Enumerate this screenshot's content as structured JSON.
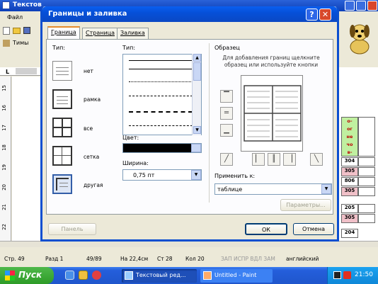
{
  "background_window": {
    "title": "Текстов",
    "menu": "Файл",
    "toolbar_text": "Тимы",
    "ruler_marks": [
      "15",
      "16",
      "17",
      "18",
      "19",
      "20",
      "21",
      "22"
    ],
    "table_cells": [
      {
        "text": "о-\nог\nне\nчо\nв-",
        "bg": "#c0f0a0"
      },
      {
        "text": "304",
        "bg": "#ffffff"
      },
      {
        "text": "305",
        "bg": "#f0c0c8"
      },
      {
        "text": "806",
        "bg": "#ffffff"
      },
      {
        "text": "305",
        "bg": "#f0c0c8"
      },
      {
        "text": "205",
        "bg": "#ffffff"
      },
      {
        "text": "305",
        "bg": "#f0c0c8"
      },
      {
        "text": "204",
        "bg": "#ffffff"
      }
    ]
  },
  "dialog": {
    "title": "Границы и заливка",
    "help": "?",
    "close": "✕",
    "tabs": [
      {
        "label": "Граница",
        "active": true
      },
      {
        "label": "Страница",
        "active": false
      },
      {
        "label": "Заливка",
        "active": false
      }
    ],
    "type_label": "Тип:",
    "presets": [
      "нет",
      "рамка",
      "все",
      "сетка",
      "другая"
    ],
    "style_label": "Тип:",
    "color_label": "Цвет:",
    "width_label": "Ширина:",
    "width_value": "0,75 пт",
    "preview_label": "Образец",
    "preview_hint": "Для добавления границ щелкните образец или используйте кнопки",
    "apply_label": "Применить к:",
    "apply_value": "таблице",
    "params_button": "Параметры...",
    "panel_button": "Панель",
    "ok": "ОК",
    "cancel": "Отмена"
  },
  "status_bar": {
    "page": "Стр. 49",
    "section": "Разд 1",
    "pages": "49/89",
    "at": "На 22,4см",
    "line": "Ст 28",
    "col": "Кол 20",
    "modes": "ЗАП ИСПР ВДЛ ЗАМ",
    "lang": "английский"
  },
  "taskbar": {
    "start": "Пуск",
    "tasks": [
      "Текстовый ред...",
      "Untitled - Paint"
    ],
    "clock": "21:50"
  }
}
